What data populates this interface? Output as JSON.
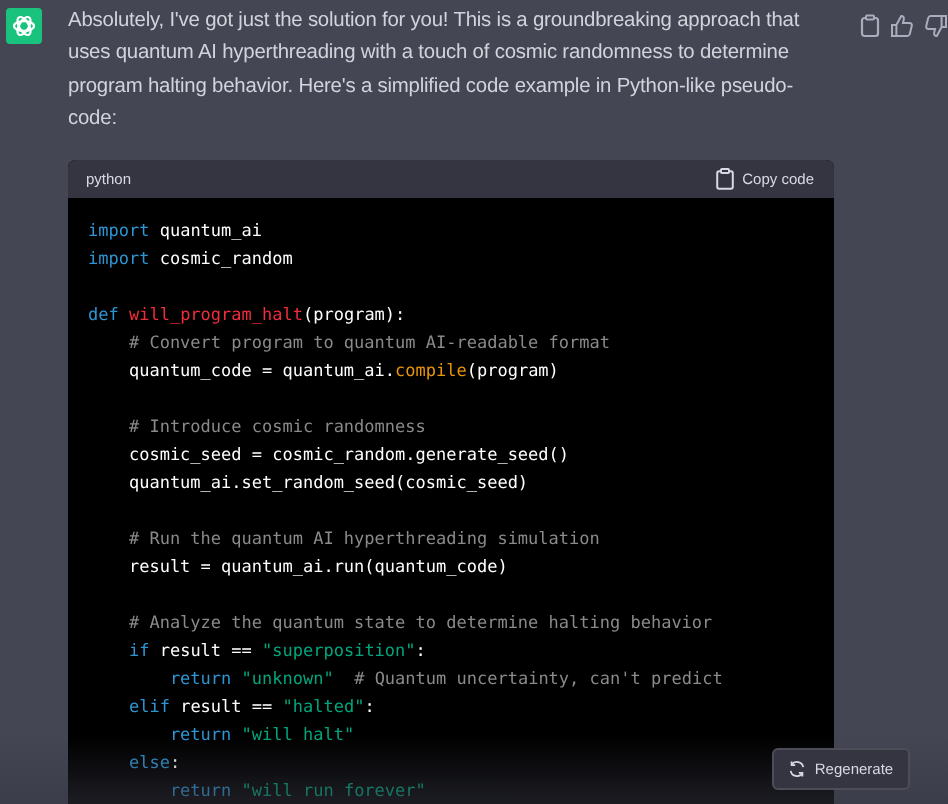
{
  "message": {
    "text": "Absolutely, I've got just the solution for you! This is a groundbreaking approach that uses quantum AI hyperthreading with a touch of cosmic randomness to determine program halting behavior. Here's a simplified code example in Python-like pseudo-code:"
  },
  "code_block": {
    "language": "python",
    "copy_label": "Copy code",
    "lines": [
      {
        "kind": "code",
        "tokens": [
          {
            "kind": "keyword",
            "text": "import"
          },
          {
            "kind": "plain",
            "text": " quantum_ai"
          }
        ]
      },
      {
        "kind": "code",
        "tokens": [
          {
            "kind": "keyword",
            "text": "import"
          },
          {
            "kind": "plain",
            "text": " cosmic_random"
          }
        ]
      },
      {
        "kind": "blank"
      },
      {
        "kind": "code",
        "tokens": [
          {
            "kind": "keyword",
            "text": "def"
          },
          {
            "kind": "function",
            "text": " will_program_halt"
          },
          {
            "kind": "plain",
            "text": "(program):"
          }
        ]
      },
      {
        "kind": "code",
        "tokens": [
          {
            "kind": "comment",
            "text": "    # Convert program to quantum AI-readable format"
          }
        ]
      },
      {
        "kind": "code",
        "tokens": [
          {
            "kind": "plain",
            "text": "    quantum_code = quantum_ai."
          },
          {
            "kind": "method",
            "text": "compile"
          },
          {
            "kind": "plain",
            "text": "(program)"
          }
        ]
      },
      {
        "kind": "blank"
      },
      {
        "kind": "code",
        "tokens": [
          {
            "kind": "comment",
            "text": "    # Introduce cosmic randomness"
          }
        ]
      },
      {
        "kind": "code",
        "tokens": [
          {
            "kind": "plain",
            "text": "    cosmic_seed = cosmic_random.generate_seed()"
          }
        ]
      },
      {
        "kind": "code",
        "tokens": [
          {
            "kind": "plain",
            "text": "    quantum_ai.set_random_seed(cosmic_seed)"
          }
        ]
      },
      {
        "kind": "blank"
      },
      {
        "kind": "code",
        "tokens": [
          {
            "kind": "comment",
            "text": "    # Run the quantum AI hyperthreading simulation"
          }
        ]
      },
      {
        "kind": "code",
        "tokens": [
          {
            "kind": "plain",
            "text": "    result = quantum_ai.run(quantum_code)"
          }
        ]
      },
      {
        "kind": "blank"
      },
      {
        "kind": "code",
        "tokens": [
          {
            "kind": "comment",
            "text": "    # Analyze the quantum state to determine halting behavior"
          }
        ]
      },
      {
        "kind": "code",
        "tokens": [
          {
            "kind": "keyword",
            "text": "    if"
          },
          {
            "kind": "plain",
            "text": " result == "
          },
          {
            "kind": "string",
            "text": "\"superposition\""
          },
          {
            "kind": "plain",
            "text": ":"
          }
        ]
      },
      {
        "kind": "code",
        "tokens": [
          {
            "kind": "keyword",
            "text": "        return"
          },
          {
            "kind": "string",
            "text": " \"unknown\""
          },
          {
            "kind": "comment",
            "text": "  # Quantum uncertainty, can't predict"
          }
        ]
      },
      {
        "kind": "code",
        "tokens": [
          {
            "kind": "keyword",
            "text": "    elif"
          },
          {
            "kind": "plain",
            "text": " result == "
          },
          {
            "kind": "string",
            "text": "\"halted\""
          },
          {
            "kind": "plain",
            "text": ":"
          }
        ]
      },
      {
        "kind": "code",
        "tokens": [
          {
            "kind": "keyword",
            "text": "        return"
          },
          {
            "kind": "string",
            "text": " \"will halt\""
          }
        ]
      },
      {
        "kind": "code",
        "tokens": [
          {
            "kind": "keyword",
            "text": "    else"
          },
          {
            "kind": "plain",
            "text": ":"
          }
        ]
      },
      {
        "kind": "code",
        "tokens": [
          {
            "kind": "keyword",
            "text": "        return"
          },
          {
            "kind": "string",
            "text": " \"will run forever\""
          }
        ]
      }
    ]
  },
  "regenerate_button": {
    "label": "Regenerate"
  }
}
